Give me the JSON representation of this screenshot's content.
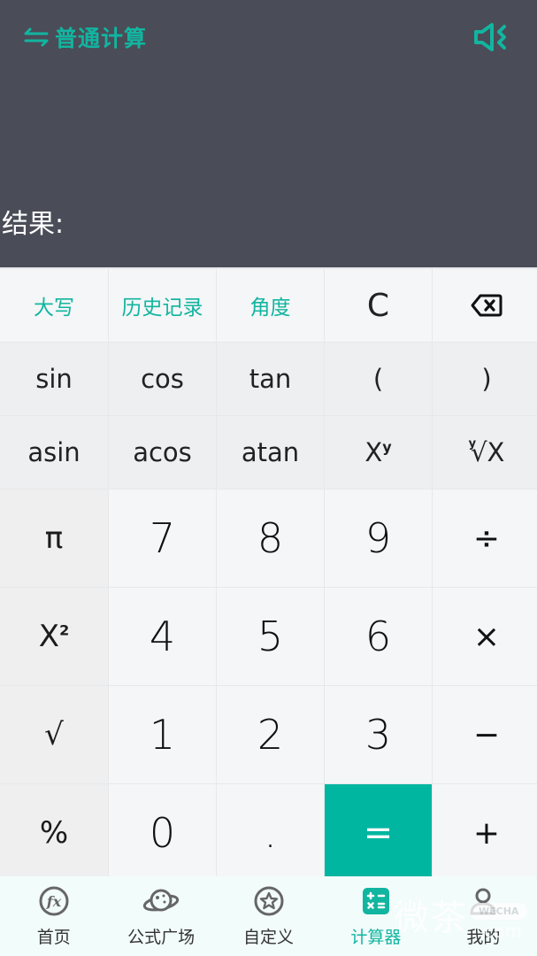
{
  "header": {
    "mode_label": "普通计算",
    "mode_icon": "swap-arrows-icon",
    "sound_icon": "speaker-mute-icon",
    "result_label": "结果:"
  },
  "colors": {
    "accent": "#12b5a0",
    "header_bg": "#4a4c57",
    "equals_bg": "#00b6a1",
    "key_bg": "#f4f6f7",
    "tabbar_bg": "#f2fcfa"
  },
  "keypad": {
    "row1": [
      "大写",
      "历史记录",
      "角度",
      "C",
      "backspace"
    ],
    "row2": [
      "sin",
      "cos",
      "tan",
      "(",
      ")"
    ],
    "row3": [
      "asin",
      "acos",
      "atan",
      "Xʸ",
      "ʸ√X"
    ],
    "row4": [
      "π",
      "7",
      "8",
      "9",
      "÷"
    ],
    "row5": [
      "X²",
      "4",
      "5",
      "6",
      "×"
    ],
    "row6": [
      "√",
      "1",
      "2",
      "3",
      "−"
    ],
    "row7": [
      "%",
      "0",
      ".",
      "=",
      "+"
    ]
  },
  "tabs": [
    {
      "label": "首页",
      "icon": "fx-circle-icon",
      "active": false
    },
    {
      "label": "公式广场",
      "icon": "planet-icon",
      "active": false
    },
    {
      "label": "自定义",
      "icon": "star-circle-icon",
      "active": false
    },
    {
      "label": "计算器",
      "icon": "calculator-icon",
      "active": true
    },
    {
      "label": "我的",
      "icon": "user-icon",
      "active": false
    }
  ],
  "watermark": {
    "text": "微茶",
    "badge": "WECHA",
    "suffix": ".com"
  }
}
